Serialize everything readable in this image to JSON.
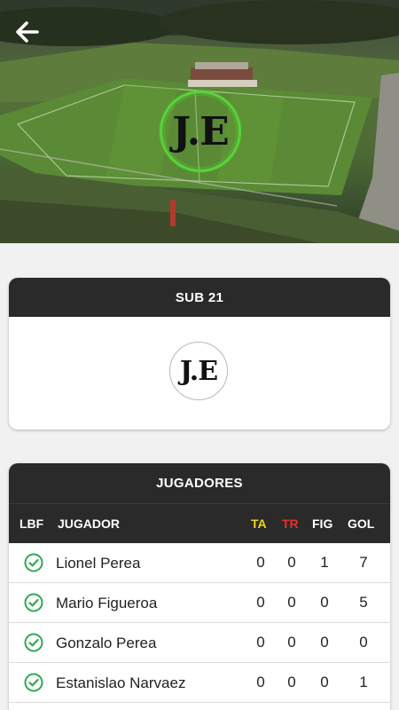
{
  "header": {
    "back_icon": "arrow-left-icon",
    "crest_text": "J.E",
    "crest_ring_color": "#5bd13a"
  },
  "team": {
    "title": "SUB 21",
    "logo_text": "J.E"
  },
  "players": {
    "title": "JUGADORES",
    "columns": {
      "lbf": "LBF",
      "player": "JUGADOR",
      "ta": "TA",
      "tr": "TR",
      "fig": "FIG",
      "gol": "GOL"
    },
    "column_colors": {
      "ta": "#f2d21b",
      "tr": "#e0322b"
    },
    "rows": [
      {
        "name": "Lionel Perea",
        "ta": "0",
        "tr": "0",
        "fig": "1",
        "gol": "7",
        "lbf_icon": "check-circle-icon"
      },
      {
        "name": "Mario Figueroa",
        "ta": "0",
        "tr": "0",
        "fig": "0",
        "gol": "5",
        "lbf_icon": "check-circle-icon"
      },
      {
        "name": "Gonzalo Perea",
        "ta": "0",
        "tr": "0",
        "fig": "0",
        "gol": "0",
        "lbf_icon": "check-circle-icon"
      },
      {
        "name": "Estanislao Narvaez",
        "ta": "0",
        "tr": "0",
        "fig": "0",
        "gol": "1",
        "lbf_icon": "check-circle-icon"
      }
    ]
  }
}
